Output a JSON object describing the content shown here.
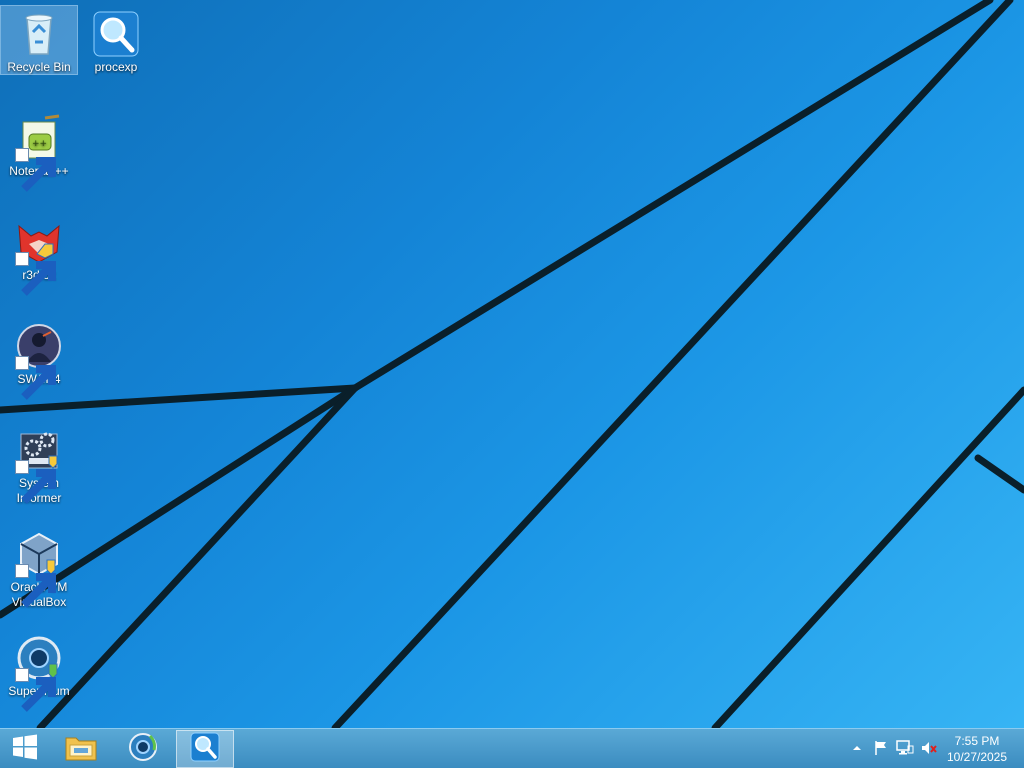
{
  "desktop": {
    "icons": [
      {
        "label": "Recycle Bin",
        "icon": "recycle-bin-icon",
        "selected": true
      },
      {
        "label": "procexp",
        "icon": "magnifier-icon"
      },
      {
        "label": "Notepad++",
        "icon": "notepad-plus-plus-icon"
      },
      {
        "label": "r3dfox",
        "icon": "fox-icon"
      },
      {
        "label": "SWAT 4",
        "icon": "swat-4-icon"
      },
      {
        "label": "System Informer",
        "icon": "gears-icon"
      },
      {
        "label": "Oracle VM VirtualBox",
        "icon": "virtualbox-icon"
      },
      {
        "label": "Supermium",
        "icon": "browser-globe-icon"
      }
    ]
  },
  "taskbar": {
    "items": [
      {
        "name": "start",
        "icon": "windows-logo-icon"
      },
      {
        "name": "file-explorer",
        "icon": "folder-icon"
      },
      {
        "name": "supermium",
        "icon": "browser-globe-icon"
      },
      {
        "name": "procexp",
        "icon": "magnifier-icon",
        "active": true
      }
    ],
    "tray": [
      "chevron-up-icon",
      "flag-icon",
      "network-icon",
      "volume-muted-icon"
    ]
  },
  "clock": {
    "time": "7:55 PM",
    "date": "10/27/2025"
  },
  "colors": {
    "wallpaper_dark": "#0f6fb8",
    "wallpaper_light": "#38b6f5",
    "taskbar": "#4a9ccc"
  }
}
